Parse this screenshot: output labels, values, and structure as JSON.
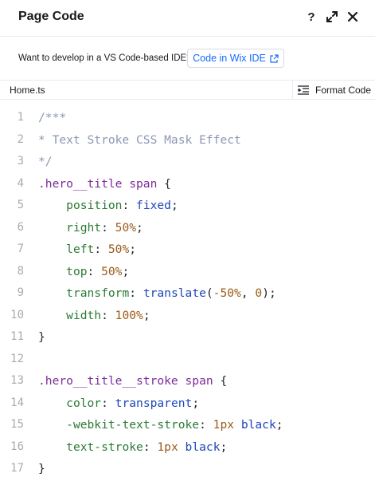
{
  "header": {
    "title": "Page Code",
    "help": "?"
  },
  "ide": {
    "prompt": "Want to develop in a VS Code-based IDE?",
    "button_label": "Code in Wix IDE"
  },
  "tabs": {
    "file": "Home.ts",
    "format_label": "Format Code"
  },
  "colors": {
    "accent": "#116dff",
    "comment": "#8a97b4",
    "selector": "#7d2b98",
    "property": "#2a7a34",
    "keyword": "#1d47b8",
    "number": "#9a5a1a",
    "line_number": "#a7abb3"
  },
  "code_lines": [
    {
      "n": "1",
      "tokens": [
        {
          "t": "/***",
          "c": "comment"
        }
      ]
    },
    {
      "n": "2",
      "tokens": [
        {
          "t": "* Text Stroke CSS Mask Effect",
          "c": "comment"
        }
      ]
    },
    {
      "n": "3",
      "tokens": [
        {
          "t": "*/",
          "c": "comment"
        }
      ]
    },
    {
      "n": "4",
      "tokens": [
        {
          "t": ".hero__title span",
          "c": "selector"
        },
        {
          "t": " {",
          "c": "punct"
        }
      ]
    },
    {
      "n": "5",
      "tokens": [
        {
          "t": "    ",
          "c": "punct"
        },
        {
          "t": "position",
          "c": "prop"
        },
        {
          "t": ": ",
          "c": "punct"
        },
        {
          "t": "fixed",
          "c": "kw"
        },
        {
          "t": ";",
          "c": "punct"
        }
      ]
    },
    {
      "n": "6",
      "tokens": [
        {
          "t": "    ",
          "c": "punct"
        },
        {
          "t": "right",
          "c": "prop"
        },
        {
          "t": ": ",
          "c": "punct"
        },
        {
          "t": "50%",
          "c": "num"
        },
        {
          "t": ";",
          "c": "punct"
        }
      ]
    },
    {
      "n": "7",
      "tokens": [
        {
          "t": "    ",
          "c": "punct"
        },
        {
          "t": "left",
          "c": "prop"
        },
        {
          "t": ": ",
          "c": "punct"
        },
        {
          "t": "50%",
          "c": "num"
        },
        {
          "t": ";",
          "c": "punct"
        }
      ]
    },
    {
      "n": "8",
      "tokens": [
        {
          "t": "    ",
          "c": "punct"
        },
        {
          "t": "top",
          "c": "prop"
        },
        {
          "t": ": ",
          "c": "punct"
        },
        {
          "t": "50%",
          "c": "num"
        },
        {
          "t": ";",
          "c": "punct"
        }
      ]
    },
    {
      "n": "9",
      "tokens": [
        {
          "t": "    ",
          "c": "punct"
        },
        {
          "t": "transform",
          "c": "prop"
        },
        {
          "t": ": ",
          "c": "punct"
        },
        {
          "t": "translate",
          "c": "kw"
        },
        {
          "t": "(",
          "c": "punct"
        },
        {
          "t": "-50%",
          "c": "num"
        },
        {
          "t": ", ",
          "c": "punct"
        },
        {
          "t": "0",
          "c": "num"
        },
        {
          "t": ");",
          "c": "punct"
        }
      ]
    },
    {
      "n": "10",
      "tokens": [
        {
          "t": "    ",
          "c": "punct"
        },
        {
          "t": "width",
          "c": "prop"
        },
        {
          "t": ": ",
          "c": "punct"
        },
        {
          "t": "100%",
          "c": "num"
        },
        {
          "t": ";",
          "c": "punct"
        }
      ]
    },
    {
      "n": "11",
      "tokens": [
        {
          "t": "}",
          "c": "punct"
        }
      ]
    },
    {
      "n": "12",
      "tokens": []
    },
    {
      "n": "13",
      "tokens": [
        {
          "t": ".hero__title__stroke span",
          "c": "selector"
        },
        {
          "t": " {",
          "c": "punct"
        }
      ]
    },
    {
      "n": "14",
      "tokens": [
        {
          "t": "    ",
          "c": "punct"
        },
        {
          "t": "color",
          "c": "prop"
        },
        {
          "t": ": ",
          "c": "punct"
        },
        {
          "t": "transparent",
          "c": "kw"
        },
        {
          "t": ";",
          "c": "punct"
        }
      ]
    },
    {
      "n": "15",
      "tokens": [
        {
          "t": "    ",
          "c": "punct"
        },
        {
          "t": "-webkit-text-stroke",
          "c": "prop"
        },
        {
          "t": ": ",
          "c": "punct"
        },
        {
          "t": "1px",
          "c": "num"
        },
        {
          "t": " ",
          "c": "punct"
        },
        {
          "t": "black",
          "c": "kw"
        },
        {
          "t": ";",
          "c": "punct"
        }
      ]
    },
    {
      "n": "16",
      "tokens": [
        {
          "t": "    ",
          "c": "punct"
        },
        {
          "t": "text-stroke",
          "c": "prop"
        },
        {
          "t": ": ",
          "c": "punct"
        },
        {
          "t": "1px",
          "c": "num"
        },
        {
          "t": " ",
          "c": "punct"
        },
        {
          "t": "black",
          "c": "kw"
        },
        {
          "t": ";",
          "c": "punct"
        }
      ]
    },
    {
      "n": "17",
      "tokens": [
        {
          "t": "}",
          "c": "punct"
        }
      ]
    }
  ]
}
